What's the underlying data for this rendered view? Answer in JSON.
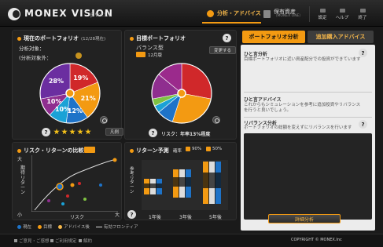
{
  "header": {
    "brand": "MONEX VISION",
    "version": "β Ver.1.1",
    "tab_active": "分析・アドバイス",
    "tab_holdings_main": "保有資産",
    "tab_holdings_sub": "（MONEX ONE）",
    "btn_settings": "設定",
    "btn_help": "ヘルプ",
    "btn_exit": "終了"
  },
  "current_portfolio": {
    "title": "現在のポートフォリオ",
    "date": "(12/28現在)",
    "target_label": "分析対象：",
    "excluded_label": "(分析対象外：",
    "legend_button": "凡例",
    "rating_stars": 5,
    "slices": [
      {
        "label": "19%",
        "value": 19,
        "color": "#d0282a"
      },
      {
        "label": "21%",
        "value": 21,
        "color": "#f39a12"
      },
      {
        "label": "12%",
        "value": 12,
        "color": "#1e73c8"
      },
      {
        "label": "10%",
        "value": 10,
        "color": "#1aa2d6"
      },
      {
        "label": "10%",
        "value": 10,
        "color": "#8f2e8f"
      },
      {
        "label": "28%",
        "value": 28,
        "color": "#6b2ea0"
      }
    ]
  },
  "target_portfolio": {
    "title": "目標ポートフォリオ",
    "type_name": "バランス型",
    "month": "12月版",
    "change_button": "変更する",
    "risk_text": "リスク：年率13%程度",
    "slices": [
      {
        "value": 28,
        "color": "#d0282a"
      },
      {
        "value": 27,
        "color": "#f39a12"
      },
      {
        "value": 9,
        "color": "#1e73c8"
      },
      {
        "value": 4,
        "color": "#1aa2d6"
      },
      {
        "value": 4,
        "color": "#7ec242"
      },
      {
        "value": 14,
        "color": "#8f2e8f"
      },
      {
        "value": 14,
        "color": "#9b2a8c"
      }
    ]
  },
  "risk_return": {
    "title": "リスク・リターンの比較",
    "y_axis_label": "期待リターン",
    "x_axis_label": "リスク",
    "y_high": "大",
    "y_low": "小",
    "x_high": "大",
    "legend_current": "現在",
    "legend_target": "目標",
    "legend_advice": "アドバイス後",
    "legend_frontier": "有効フロンティア"
  },
  "return_forecast": {
    "title": "リターン予測",
    "probability_label": "確率",
    "prob_90": "90%",
    "prob_50": "50%",
    "y_axis_label": "参考リターン",
    "periods": [
      "1年後",
      "3年後",
      "5年後"
    ]
  },
  "advice_panel": {
    "tab_analysis": "ポートフォリオ分析",
    "tab_purchase": "追加購入アドバイス",
    "section1_title": "ひと言分析",
    "section1_text": "目標ポートフォリオに近い資産配分での投資ができています",
    "section2_title": "ひと言アドバイス",
    "section2_text": "これからもシミュレーションを参考に追加投資やリバランスを行うと良いでしょう。",
    "section3_title": "リバランス分析",
    "section3_text": "ポートフォリオの総額を変えずにリバランスを行います",
    "detail_button": "詳細分析"
  },
  "footer": {
    "link1": "ご意見・ご感想",
    "link2": "ご利用規定",
    "link3": "解約",
    "copyright": "COPYRIGHT © MONEX.Inc"
  }
}
